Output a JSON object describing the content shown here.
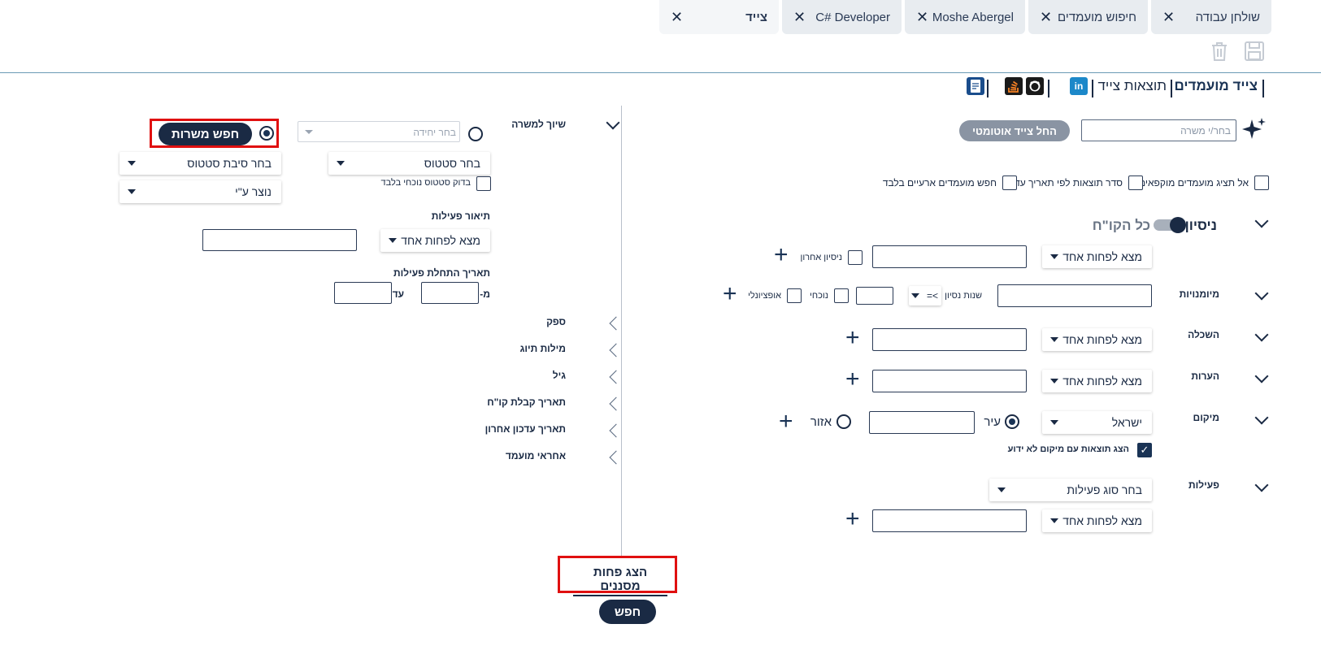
{
  "tabs": [
    {
      "label": "שולחן עבודה",
      "close": "✕"
    },
    {
      "label": "חיפוש מועמדים",
      "close": "✕"
    },
    {
      "label": "Moshe Abergel",
      "close": "✕"
    },
    {
      "label": "C# Developer",
      "close": "✕"
    },
    {
      "label": "צייד",
      "close": "✕"
    }
  ],
  "toolbar": {
    "save_icon": "save-icon",
    "delete_icon": "trash-icon"
  },
  "nav": {
    "candidates_hunter": "צייד מועמדים",
    "hunter_results": "תוצאות צייד",
    "icons": [
      "linkedin-icon",
      "github-icon",
      "stackoverflow-icon",
      "document-icon"
    ],
    "linkedin_text": "in"
  },
  "search": {
    "position_placeholder": "בחר/י משרה",
    "auto_hunt_button": "החל צייד אוטומטי"
  },
  "options": {
    "no_recruited": "אל תציג מועמדים מוקפאים",
    "sort_by_update": "סדר תוצאות לפי תאריך עדכון",
    "temporary_only": "חפש מועמדים ארעיים בלבד"
  },
  "experience": {
    "title": "ניסיון",
    "toggle_label": "כל הקו\"ח",
    "match": "מצא לפחות אחד",
    "last_experience": "ניסיון אחרון"
  },
  "skills": {
    "title": "מיומנויות",
    "years_label": "שנות נסיון",
    "operator": ">=",
    "current": "נוכחי",
    "optional": "אופציונלי"
  },
  "education": {
    "title": "השכלה",
    "match": "מצא לפחות אחד"
  },
  "notes": {
    "title": "הערות",
    "match": "מצא לפחות אחד"
  },
  "location": {
    "title": "מיקום",
    "country": "ישראל",
    "city": "עיר",
    "area": "אזור",
    "unknown_location": "הצג תוצאות עם מיקום לא ידוע"
  },
  "activity": {
    "title": "פעילות",
    "type_select": "בחר סוג פעילות",
    "match": "מצא לפחות אחד"
  },
  "job_assignment": {
    "title": "שיוך למשרה",
    "unit_placeholder": "בחר יחידה",
    "search_jobs_button": "חפש משרות",
    "status_select": "בחר סטטוס",
    "status_reason_select": "בחר סיבת סטטוס",
    "current_status_only": "בדוק סטטוס נוכחי בלבד",
    "created_by": "נוצר ע\"י",
    "activity_description": "תיאור פעילות",
    "activity_match": "מצא לפחות אחד",
    "activity_start_date": "תאריך התחלת פעילות",
    "from": "מ-",
    "to": "עד"
  },
  "collapsed_sections": [
    "ספק",
    "מילות תיוג",
    "גיל",
    "תאריך קבלת קו\"ח",
    "תאריך עדכון אחרון",
    "אחראי מועמד"
  ],
  "footer": {
    "show_less_filters": "הצג פחות מסננים",
    "search_button": "חפש"
  },
  "colors": {
    "accent": "#1a2a44",
    "highlight": "#e01010",
    "tab_bg": "#e8ecf0"
  }
}
